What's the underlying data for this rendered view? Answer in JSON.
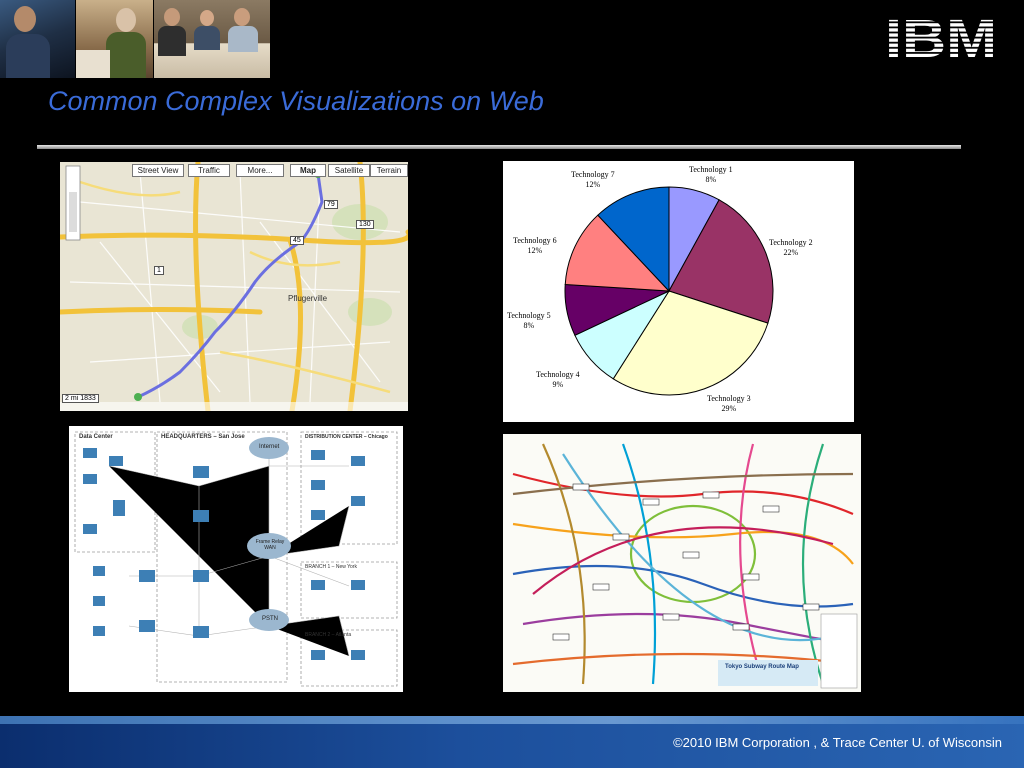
{
  "slide": {
    "title": "Common Complex Visualizations on Web",
    "footer": "©2010 IBM Corporation , &  Trace Center U. of Wisconsin"
  },
  "logo": {
    "text": "IBM",
    "color": "#ffffff"
  },
  "map": {
    "buttons": [
      "Street View",
      "Traffic",
      "More...",
      "Map",
      "Satellite",
      "Terrain"
    ],
    "scale": "2 mi",
    "scale2": "1833",
    "place_pflugerville": "Pflugerville",
    "highway_130": "130",
    "highway_45": "45",
    "highway_1": "1",
    "highway_79": "79"
  },
  "pie": {
    "labels": [
      {
        "name": "Technology 1",
        "pct": "8%"
      },
      {
        "name": "Technology 2",
        "pct": "22%"
      },
      {
        "name": "Technology 3",
        "pct": "29%"
      },
      {
        "name": "Technology 4",
        "pct": "9%"
      },
      {
        "name": "Technology 5",
        "pct": "8%"
      },
      {
        "name": "Technology 6",
        "pct": "12%"
      },
      {
        "name": "Technology 7",
        "pct": "12%"
      }
    ]
  },
  "chart_data": {
    "type": "pie",
    "categories": [
      "Technology 1",
      "Technology 2",
      "Technology 3",
      "Technology 4",
      "Technology 5",
      "Technology 6",
      "Technology 7"
    ],
    "values": [
      8,
      22,
      29,
      9,
      8,
      12,
      12
    ],
    "colors": [
      "#9999ff",
      "#993366",
      "#ffffcc",
      "#ccffff",
      "#660066",
      "#ff8080",
      "#0066cc"
    ]
  },
  "network": {
    "title_dc": "Data Center",
    "title_hq": "HEADQUARTERS – San Jose",
    "title_dist": "DISTRIBUTION CENTER – Chicago",
    "cloud_internet": "Internet",
    "cloud_frame": "Frame Relay WAN",
    "cloud_pstn": "PSTN",
    "branch1": "BRANCH 1 – New York",
    "branch2": "BRANCH 2 – Atlanta"
  },
  "subway": {
    "title": "Tokyo Subway Route Map"
  }
}
